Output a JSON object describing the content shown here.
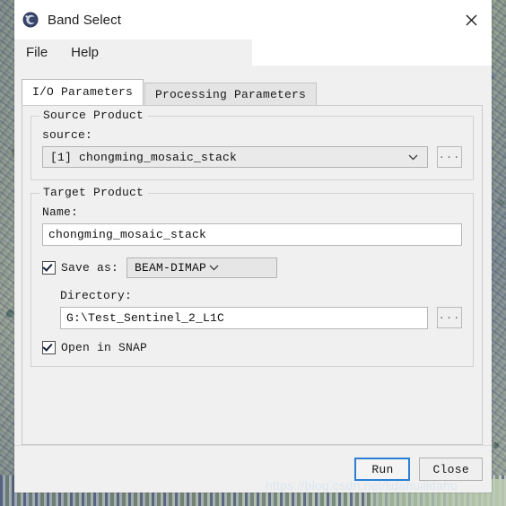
{
  "window": {
    "title": "Band Select",
    "app_icon": "snap-globe-icon",
    "close_icon": "close-icon"
  },
  "menubar": {
    "items": [
      {
        "label": "File",
        "name": "menu-file"
      },
      {
        "label": "Help",
        "name": "menu-help"
      }
    ]
  },
  "tabs": [
    {
      "label": "I/O Parameters",
      "active": true
    },
    {
      "label": "Processing Parameters",
      "active": false
    }
  ],
  "source_product": {
    "group_title": "Source Product",
    "source_label": "source:",
    "source_value": "[1] chongming_mosaic_stack",
    "browse_label": "...",
    "dropdown_icon": "chevron-down-icon"
  },
  "target_product": {
    "group_title": "Target Product",
    "name_label": "Name:",
    "name_value": "chongming_mosaic_stack",
    "save_as_label": "Save as:",
    "save_as_checked": true,
    "save_as_format": "BEAM-DIMAP",
    "directory_label": "Directory:",
    "directory_value": "G:\\Test_Sentinel_2_L1C",
    "browse_label": "...",
    "open_in_snap_label": "Open in SNAP",
    "open_in_snap_checked": true,
    "dropdown_icon": "chevron-down-icon"
  },
  "buttons": {
    "run_label": "Run",
    "close_label": "Close"
  },
  "watermark": {
    "text": "https://blog.csdn.net/lidahuilidahu"
  },
  "colors": {
    "accent": "#2a7fd4",
    "panel_bg": "#f0f0f0",
    "field_bg": "#ffffff",
    "combo_bg": "#eaeaea"
  }
}
